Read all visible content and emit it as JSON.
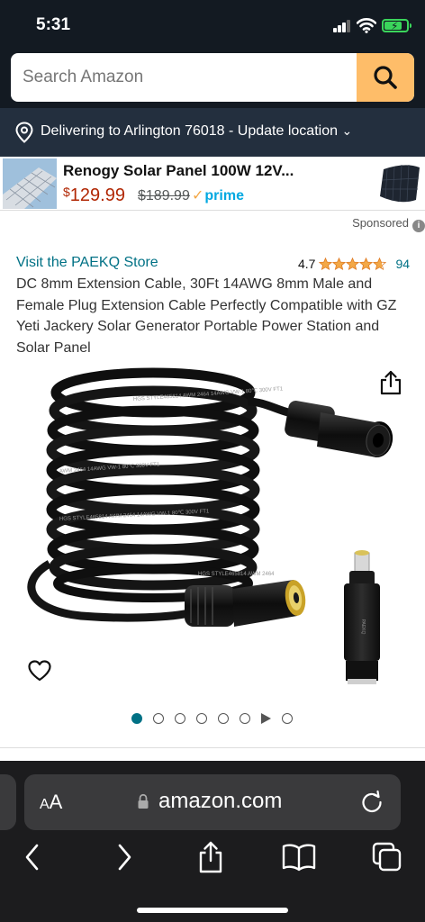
{
  "status": {
    "time": "5:31",
    "battery_level": 0.8
  },
  "search": {
    "placeholder": "Search Amazon",
    "icon": "search-icon"
  },
  "location": {
    "text": "Delivering to Arlington 76018 - Update location",
    "chevron": "⌄"
  },
  "ad": {
    "title": "Renogy Solar Panel 100W 12V...",
    "price_symbol": "$",
    "price": "129.99",
    "old_price": "$189.99",
    "prime_label": "prime",
    "prime_check": "✓"
  },
  "sponsored": {
    "label": "Sponsored",
    "info": "i"
  },
  "product": {
    "store_link": "Visit the PAEKQ Store",
    "rating": "4.7",
    "rating_value": 4.7,
    "rating_count": "94",
    "title": "DC 8mm Extension Cable, 30Ft 14AWG 8mm Male and Female Plug Extension Cable Perfectly Compatible with GZ Yeti Jackery Solar Generator Portable Power Station and Solar Panel",
    "cable_print_1": "HGS STYLE465814 AWM 2464 14AWG VW-1 80℃ 300V FT1",
    "cable_print_2": "AWM 2464 14AWG VW-1 80℃ 300V FT1",
    "cable_print_3": "HGS STYLE465814 AWM 2464 14AWG VW-1 80℃ 300V FT1",
    "cable_print_4": "HGS STYLE465814 AWM 2464",
    "adapter_print": "PAEKQ"
  },
  "carousel": {
    "count": 8,
    "active_index": 0,
    "video_index": 6
  },
  "browser": {
    "aa_small": "A",
    "aa_large": "A",
    "url": "amazon.com"
  },
  "colors": {
    "header_bg": "#131a22",
    "location_bg": "#232f3e",
    "search_button": "#febd69",
    "link": "#007185",
    "price": "#b12704",
    "star": "#f3a847",
    "prime": "#00a8e1"
  }
}
